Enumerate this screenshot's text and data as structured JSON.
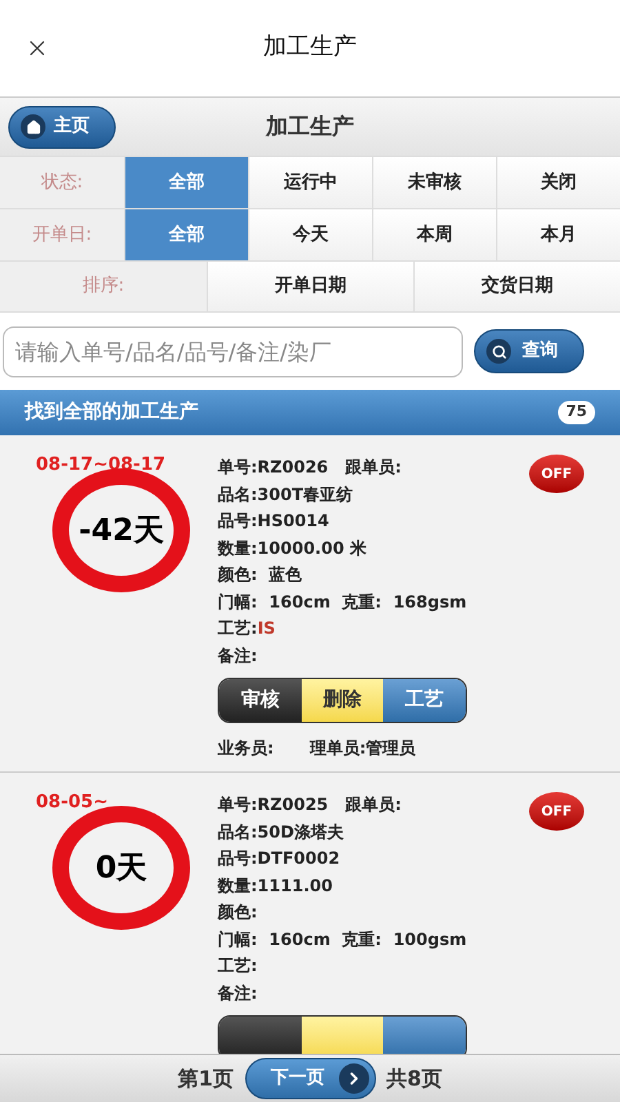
{
  "top_bar": {
    "title": "加工生产"
  },
  "header": {
    "home": "主页",
    "title": "加工生产"
  },
  "filters": [
    {
      "label": "状态:",
      "options": [
        {
          "label": "全部",
          "selected": true
        },
        {
          "label": "运行中",
          "selected": false
        },
        {
          "label": "未审核",
          "selected": false
        },
        {
          "label": "关闭",
          "selected": false
        }
      ]
    },
    {
      "label": "开单日:",
      "options": [
        {
          "label": "全部",
          "selected": true
        },
        {
          "label": "今天",
          "selected": false
        },
        {
          "label": "本周",
          "selected": false
        },
        {
          "label": "本月",
          "selected": false
        }
      ]
    }
  ],
  "sort": {
    "label": "排序:",
    "options": [
      {
        "label": "开单日期",
        "selected": false
      },
      {
        "label": "交货日期",
        "selected": false
      }
    ]
  },
  "search": {
    "placeholder": "请输入单号/品名/品号/备注/染厂",
    "button": "查询"
  },
  "results": {
    "title": "找到全部的加工生产",
    "count": "75"
  },
  "cards": [
    {
      "dates": "08-17~08-17",
      "days": "-42天",
      "toggle": {
        "label": "OFF",
        "on": false
      },
      "lines": [
        {
          "text": "单号:RZ0026   跟单员:"
        },
        {
          "text": "品名:300T春亚纺"
        },
        {
          "text": "品号:HS0014"
        },
        {
          "text": "数量:10000.00 米"
        },
        {
          "text": "颜色:  蓝色"
        },
        {
          "text": "门幅:  160cm  克重:  168gsm"
        },
        {
          "text": "工艺:",
          "value": "IS"
        },
        {
          "text": "备注:"
        }
      ],
      "actions": [
        {
          "label": "审核",
          "kind": "dark"
        },
        {
          "label": "删除",
          "kind": "yellow"
        },
        {
          "label": "工艺",
          "kind": "blue"
        }
      ],
      "staff": [
        {
          "text": "业务员:"
        },
        {
          "text": "理单员:管理员"
        }
      ]
    },
    {
      "dates": "08-05~",
      "days": "0天",
      "toggle": {
        "label": "OFF",
        "on": false
      },
      "lines": [
        {
          "text": "单号:RZ0025   跟单员:"
        },
        {
          "text": "品名:50D涤塔夫"
        },
        {
          "text": "品号:DTF0002"
        },
        {
          "text": "数量:1111.00"
        },
        {
          "text": "颜色:"
        },
        {
          "text": "门幅:  160cm  克重:  100gsm"
        },
        {
          "text": "工艺:"
        },
        {
          "text": "备注:"
        }
      ],
      "actions": [
        {
          "kind": "dark"
        },
        {
          "kind": "yellow"
        },
        {
          "kind": "blue"
        }
      ]
    }
  ],
  "pager": {
    "current": "第1页",
    "next": "下一页",
    "total": "共8页"
  }
}
